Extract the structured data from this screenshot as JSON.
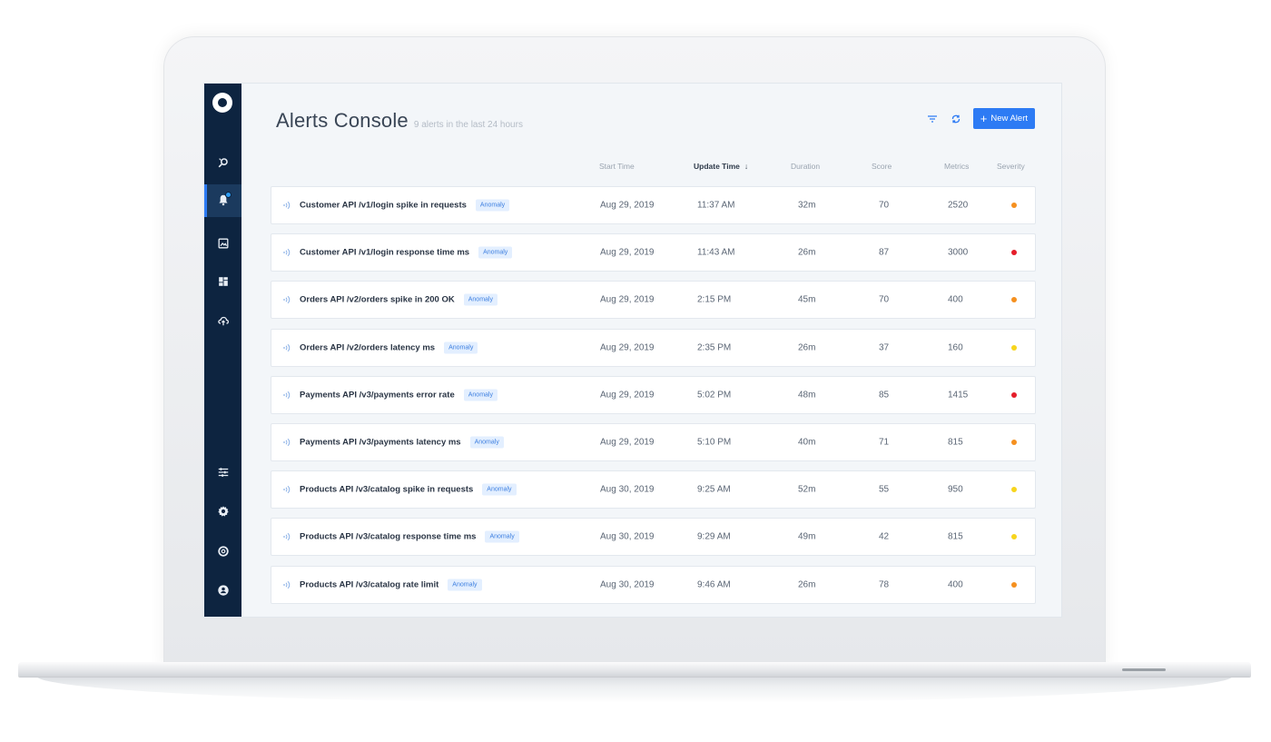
{
  "header": {
    "title": "Alerts Console",
    "subtitle": "9 alerts in the last 24 hours",
    "new_alert_label": "New Alert"
  },
  "columns": {
    "start_time": "Start Time",
    "update_time": "Update Time",
    "duration": "Duration",
    "score": "Score",
    "metrics": "Metrics",
    "severity": "Severity"
  },
  "icons": {
    "sidebar": [
      "explore-icon",
      "bell-icon",
      "image-icon",
      "dashboard-icon",
      "cloud-upload-icon",
      "sliders-icon",
      "gear-icon",
      "lifebuoy-icon",
      "user-icon"
    ],
    "toolbar": [
      "filter-icon",
      "refresh-icon"
    ],
    "row": "signal-icon"
  },
  "colors": {
    "sidebar": "#0d2440",
    "accent": "#2d7bf4",
    "severity_high": "#e51d2a",
    "severity_medium": "#f5901f",
    "severity_low": "#f7d51d"
  },
  "alerts": [
    {
      "name": "Customer API /v1/login spike in requests",
      "tag": "Anomaly",
      "start": "Aug 29, 2019",
      "update": "11:37 AM",
      "duration": "32m",
      "score": "70",
      "metrics": "2520",
      "severity_color": "#f5901f"
    },
    {
      "name": "Customer API /v1/login response time ms",
      "tag": "Anomaly",
      "start": "Aug 29, 2019",
      "update": "11:43 AM",
      "duration": "26m",
      "score": "87",
      "metrics": "3000",
      "severity_color": "#e51d2a"
    },
    {
      "name": "Orders API /v2/orders spike in 200 OK",
      "tag": "Anomaly",
      "start": "Aug 29, 2019",
      "update": "2:15 PM",
      "duration": "45m",
      "score": "70",
      "metrics": "400",
      "severity_color": "#f5901f"
    },
    {
      "name": "Orders API /v2/orders latency ms",
      "tag": "Anomaly",
      "start": "Aug 29, 2019",
      "update": "2:35 PM",
      "duration": "26m",
      "score": "37",
      "metrics": "160",
      "severity_color": "#f7d51d"
    },
    {
      "name": "Payments API /v3/payments error rate",
      "tag": "Anomaly",
      "start": "Aug 29, 2019",
      "update": "5:02 PM",
      "duration": "48m",
      "score": "85",
      "metrics": "1415",
      "severity_color": "#e51d2a"
    },
    {
      "name": "Payments API /v3/payments latency ms",
      "tag": "Anomaly",
      "start": "Aug 29, 2019",
      "update": "5:10 PM",
      "duration": "40m",
      "score": "71",
      "metrics": "815",
      "severity_color": "#f5901f"
    },
    {
      "name": "Products API /v3/catalog spike in requests",
      "tag": "Anomaly",
      "start": "Aug 30, 2019",
      "update": "9:25 AM",
      "duration": "52m",
      "score": "55",
      "metrics": "950",
      "severity_color": "#f7d51d"
    },
    {
      "name": "Products API /v3/catalog response time ms",
      "tag": "Anomaly",
      "start": "Aug 30, 2019",
      "update": "9:29 AM",
      "duration": "49m",
      "score": "42",
      "metrics": "815",
      "severity_color": "#f7d51d"
    },
    {
      "name": "Products API /v3/catalog rate limit",
      "tag": "Anomaly",
      "start": "Aug 30, 2019",
      "update": "9:46 AM",
      "duration": "26m",
      "score": "78",
      "metrics": "400",
      "severity_color": "#f5901f"
    }
  ]
}
